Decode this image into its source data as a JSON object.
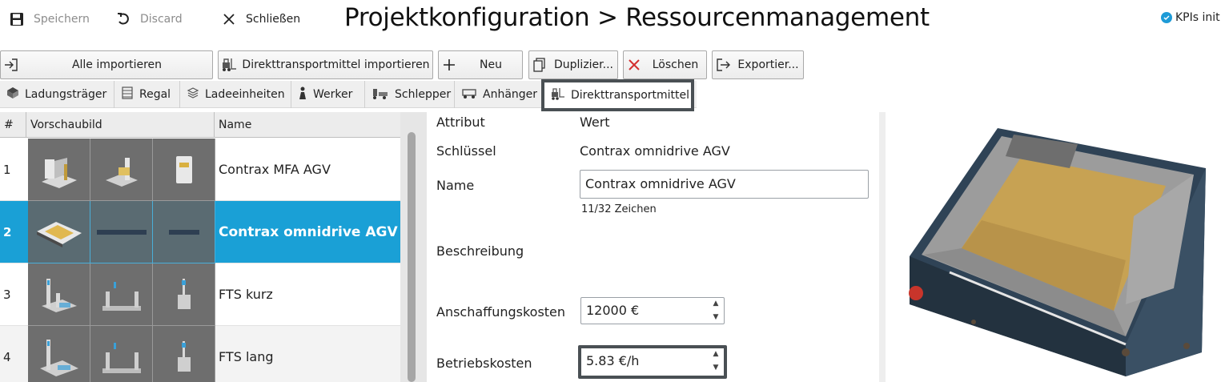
{
  "topbar": {
    "save_label": "Speichern",
    "discard_label": "Discard",
    "close_label": "Schließen",
    "title": "Projektkonfiguration > Ressourcenmanagement",
    "kpi_label": "KPIs init"
  },
  "toolbar": {
    "import_all": "Alle importieren",
    "import_direct": "Direkttransportmittel importieren",
    "new": "Neu",
    "duplicate": "Duplizier...",
    "delete": "Löschen",
    "export": "Exportier..."
  },
  "tabs": [
    {
      "label": "Ladungsträger",
      "icon": "cube-icon"
    },
    {
      "label": "Regal",
      "icon": "shelf-icon"
    },
    {
      "label": "Ladeeinheiten",
      "icon": "load-unit-icon"
    },
    {
      "label": "Werker",
      "icon": "worker-icon"
    },
    {
      "label": "Schlepper",
      "icon": "tugger-icon"
    },
    {
      "label": "Anhänger",
      "icon": "trailer-icon"
    },
    {
      "label": "Direkttransportmittel",
      "icon": "forklift-icon",
      "active": true
    }
  ],
  "table": {
    "headers": {
      "num": "#",
      "preview": "Vorschaubild",
      "name": "Name"
    },
    "rows": [
      {
        "num": "1",
        "name": "Contrax MFA AGV",
        "selected": false
      },
      {
        "num": "2",
        "name": "Contrax omnidrive AGV",
        "selected": true
      },
      {
        "num": "3",
        "name": "FTS kurz",
        "selected": false
      },
      {
        "num": "4",
        "name": "FTS lang",
        "selected": false
      }
    ]
  },
  "attributes": {
    "header_attr": "Attribut",
    "header_value": "Wert",
    "key_label": "Schlüssel",
    "key_value": "Contrax omnidrive AGV",
    "name_label": "Name",
    "name_value": "Contrax omnidrive AGV",
    "name_counter": "11/32 Zeichen",
    "description_label": "Beschreibung",
    "purchase_cost_label": "Anschaffungskosten",
    "purchase_cost_value": "12000 €",
    "operating_cost_label": "Betriebskosten",
    "operating_cost_value": "5.83 €/h"
  },
  "colors": {
    "selection": "#1aa0d6",
    "highlight_border": "#4a5054",
    "kpi_dot": "#1e9bd7",
    "delete_icon": "#d32f2f"
  }
}
